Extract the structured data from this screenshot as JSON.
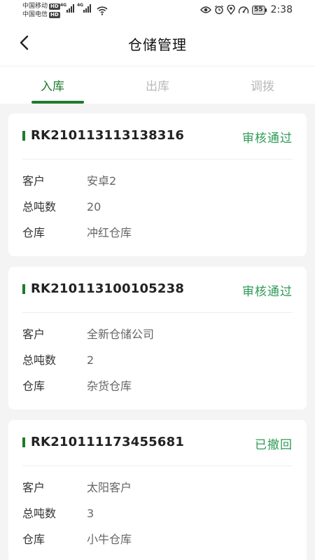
{
  "status_bar": {
    "carrier1": "中国移动",
    "carrier2": "中国电信",
    "hd": "HD",
    "net1": "4G",
    "net2": "4G",
    "battery": "55",
    "time": "2:38"
  },
  "header": {
    "title": "仓储管理",
    "back_icon": "chevron-left-icon"
  },
  "tabs": [
    {
      "label": "入库",
      "active": true
    },
    {
      "label": "出库",
      "active": false
    },
    {
      "label": "调拨",
      "active": false
    }
  ],
  "fields": {
    "customer": "客户",
    "tonnage": "总吨数",
    "warehouse": "仓库"
  },
  "records": [
    {
      "order_no": "RK210113113138316",
      "status": "审核通过",
      "customer": "安卓2",
      "tonnage": "20",
      "warehouse": "冲红仓库"
    },
    {
      "order_no": "RK210113100105238",
      "status": "审核通过",
      "customer": "全新仓储公司",
      "tonnage": "2",
      "warehouse": "杂货仓库"
    },
    {
      "order_no": "RK210111173455681",
      "status": "已撤回",
      "customer": "太阳客户",
      "tonnage": "3",
      "warehouse": "小牛仓库"
    }
  ],
  "colors": {
    "accent": "#1f7a2c",
    "status": "#2e9a55"
  }
}
